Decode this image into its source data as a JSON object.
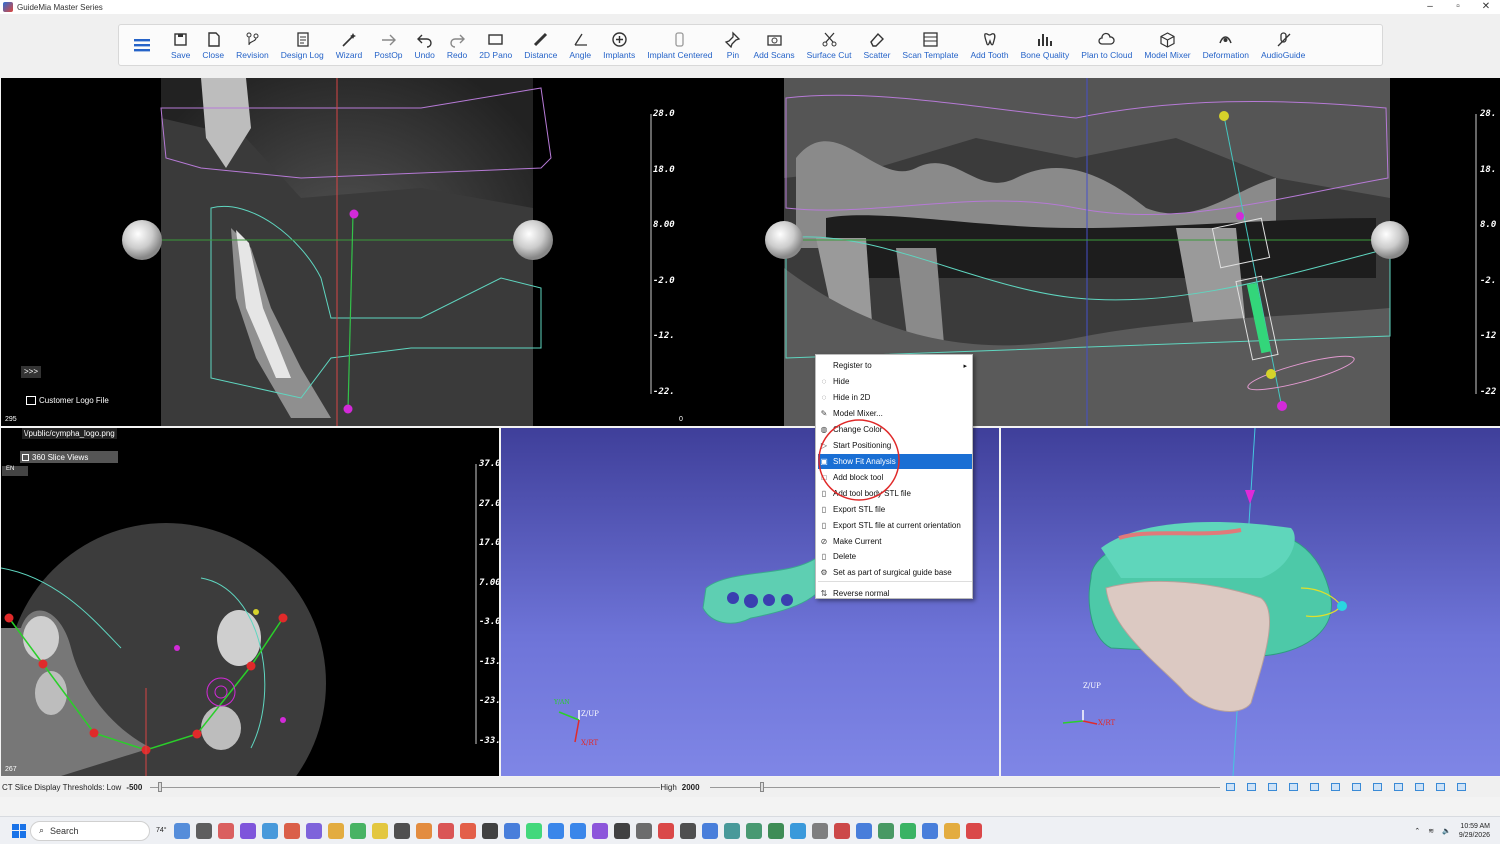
{
  "window": {
    "title": "GuideMia Master Series",
    "minimize_glyph": "–",
    "restore_glyph": "▫",
    "close_glyph": "✕"
  },
  "toolbar": {
    "items": [
      {
        "label": "Save",
        "icon": "save-icon"
      },
      {
        "label": "Close",
        "icon": "close-file-icon"
      },
      {
        "label": "Revision",
        "icon": "revision-icon"
      },
      {
        "label": "Design Log",
        "icon": "design-log-icon"
      },
      {
        "label": "Wizard",
        "icon": "wizard-icon"
      },
      {
        "label": "PostOp",
        "icon": "postop-icon"
      },
      {
        "label": "Undo",
        "icon": "undo-icon"
      },
      {
        "label": "Redo",
        "icon": "redo-icon"
      },
      {
        "label": "2D Pano",
        "icon": "pano-icon"
      },
      {
        "label": "Distance",
        "icon": "ruler-icon"
      },
      {
        "label": "Angle",
        "icon": "angle-icon"
      },
      {
        "label": "Implants",
        "icon": "plus-circle-icon"
      },
      {
        "label": "Implant Centered",
        "icon": "implant-icon"
      },
      {
        "label": "Pin",
        "icon": "pin-icon"
      },
      {
        "label": "Add Scans",
        "icon": "camera-icon"
      },
      {
        "label": "Surface Cut",
        "icon": "scissors-icon"
      },
      {
        "label": "Scatter",
        "icon": "eraser-icon"
      },
      {
        "label": "Scan Template",
        "icon": "template-icon"
      },
      {
        "label": "Add Tooth",
        "icon": "tooth-icon"
      },
      {
        "label": "Bone Quality",
        "icon": "bar-chart-icon"
      },
      {
        "label": "Plan to Cloud",
        "icon": "cloud-icon"
      },
      {
        "label": "Model Mixer",
        "icon": "cube-icon"
      },
      {
        "label": "Deformation",
        "icon": "deformation-icon"
      },
      {
        "label": "AudioGuide",
        "icon": "mic-off-icon"
      }
    ]
  },
  "viewports": {
    "sagittal": {
      "scale": [
        "28.0",
        "18.0",
        "8.00",
        "-2.0",
        "-12.",
        "-22."
      ],
      "slice_number": "295",
      "expand_button": ">>>",
      "logo_label": "Customer Logo File",
      "logo_path": "\\/public/cympha_logo.png",
      "slice_views_label": "360 Slice Views",
      "lang_label": "EN"
    },
    "pano": {
      "scale": [
        "28.",
        "18.",
        "8.0",
        "-2.",
        "-12",
        "-22"
      ],
      "slice_number": "0"
    },
    "axial": {
      "scale": [
        "37.0",
        "27.0",
        "17.0",
        "7.00",
        "-3.0",
        "-13.",
        "-23.",
        "-33."
      ],
      "slice_number": "267"
    },
    "model_view": {
      "axis_up": "Z/UP",
      "axis_rt": "X/RT",
      "axis_y": "Y/AN"
    },
    "model_3d": {
      "axis_up": "Z/UP",
      "axis_rt": "X/RT"
    }
  },
  "context_menu": {
    "items": [
      {
        "label": "Register to",
        "icon": "",
        "submenu": true
      },
      {
        "label": "Hide",
        "icon": "hide-icon"
      },
      {
        "label": "Hide in 2D",
        "icon": "hide-2d-icon"
      },
      {
        "label": "Model Mixer...",
        "icon": "mixer-icon"
      },
      {
        "label": "Change Color",
        "icon": "color-icon"
      },
      {
        "label": "Start Positioning",
        "icon": "play-icon"
      },
      {
        "label": "Show Fit Analysis",
        "icon": "analysis-icon",
        "selected": true
      },
      {
        "label": "Add block tool",
        "icon": "block-icon"
      },
      {
        "label": "Add tool body STL file",
        "icon": "file-icon"
      },
      {
        "label": "Export STL file",
        "icon": "file-icon"
      },
      {
        "label": "Export STL file at current orientation",
        "icon": "file-icon"
      },
      {
        "label": "Make Current",
        "icon": "check-circle-icon"
      },
      {
        "label": "Delete",
        "icon": "delete-icon"
      },
      {
        "label": "Set as part of surgical guide base",
        "icon": "guide-icon"
      },
      {
        "label": "Reverse normal",
        "icon": "reverse-icon"
      }
    ]
  },
  "status": {
    "threshold_label": "CT Slice Display Thresholds: Low",
    "low_value": "-500",
    "high_label": "High",
    "high_value": "2000"
  },
  "taskbar": {
    "search_placeholder": "Search",
    "time": "10:59 AM",
    "date": "9/29/2026",
    "weather": "74°"
  }
}
